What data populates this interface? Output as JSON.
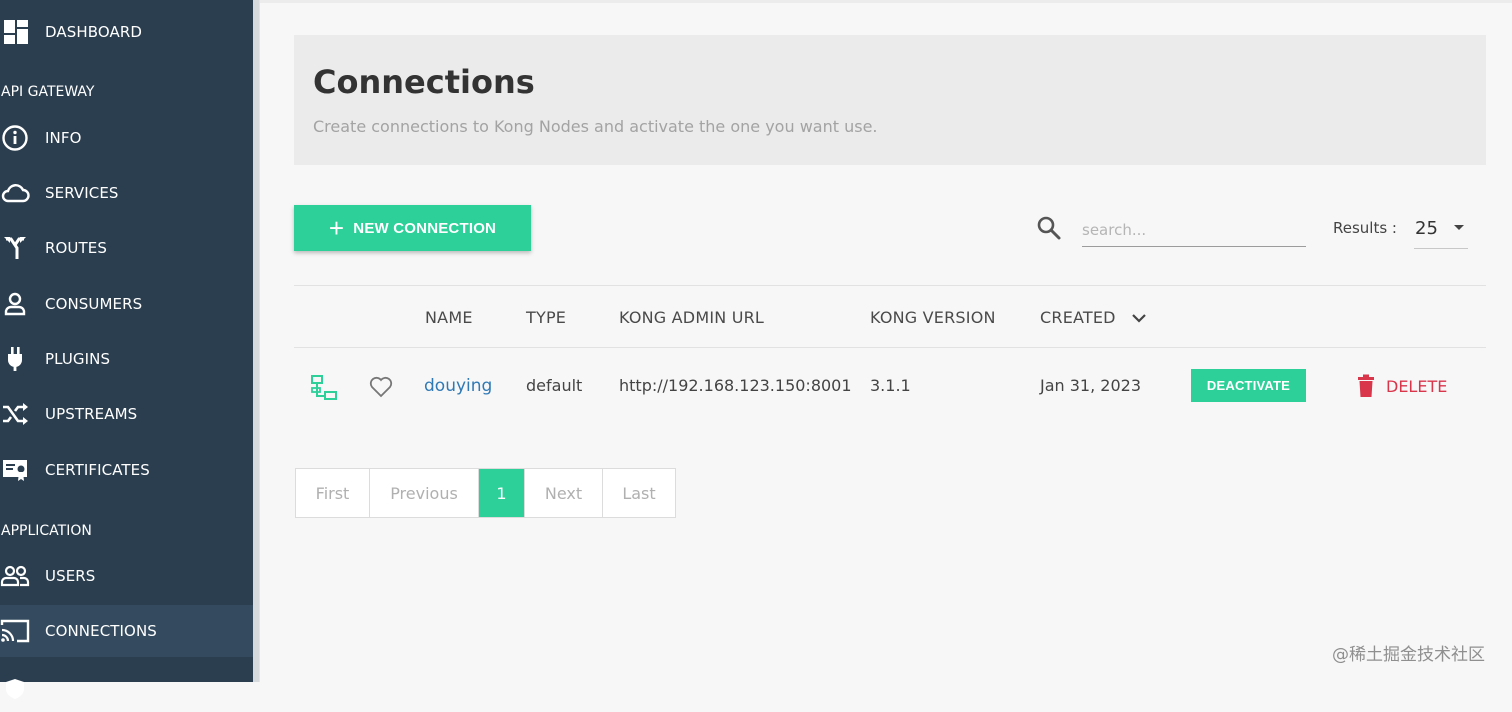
{
  "sidebar": {
    "items_top": [
      {
        "label": "DASHBOARD",
        "icon": "dashboard-icon"
      }
    ],
    "sections": [
      {
        "title": "API GATEWAY",
        "items": [
          {
            "label": "INFO",
            "icon": "info-icon"
          },
          {
            "label": "SERVICES",
            "icon": "cloud-icon"
          },
          {
            "label": "ROUTES",
            "icon": "routes-icon"
          },
          {
            "label": "CONSUMERS",
            "icon": "user-icon"
          },
          {
            "label": "PLUGINS",
            "icon": "plug-icon"
          },
          {
            "label": "UPSTREAMS",
            "icon": "shuffle-icon"
          },
          {
            "label": "CERTIFICATES",
            "icon": "certificate-icon"
          }
        ]
      },
      {
        "title": "APPLICATION",
        "items": [
          {
            "label": "USERS",
            "icon": "users-icon"
          },
          {
            "label": "CONNECTIONS",
            "icon": "cast-icon",
            "active": true
          }
        ]
      }
    ]
  },
  "header": {
    "title": "Connections",
    "subtitle": "Create connections to Kong Nodes and activate the one you want use."
  },
  "toolbar": {
    "new_connection_label": "NEW CONNECTION",
    "search_placeholder": "search...",
    "results_label": "Results :",
    "results_value": "25"
  },
  "table": {
    "columns": [
      "NAME",
      "TYPE",
      "KONG ADMIN URL",
      "KONG VERSION",
      "CREATED"
    ],
    "rows": [
      {
        "name": "douying",
        "type": "default",
        "kong_admin_url": "http://192.168.123.150:8001",
        "kong_version": "3.1.1",
        "created": "Jan 31, 2023",
        "deactivate_label": "DEACTIVATE",
        "delete_label": "DELETE"
      }
    ]
  },
  "pagination": {
    "first": "First",
    "previous": "Previous",
    "current": "1",
    "next": "Next",
    "last": "Last"
  },
  "watermark": "@稀土掘金技术社区",
  "colors": {
    "sidebar_bg": "#2b3e4f",
    "accent_green": "#2ed09a",
    "link_blue": "#2f79b5",
    "danger_red": "#d9354b"
  }
}
